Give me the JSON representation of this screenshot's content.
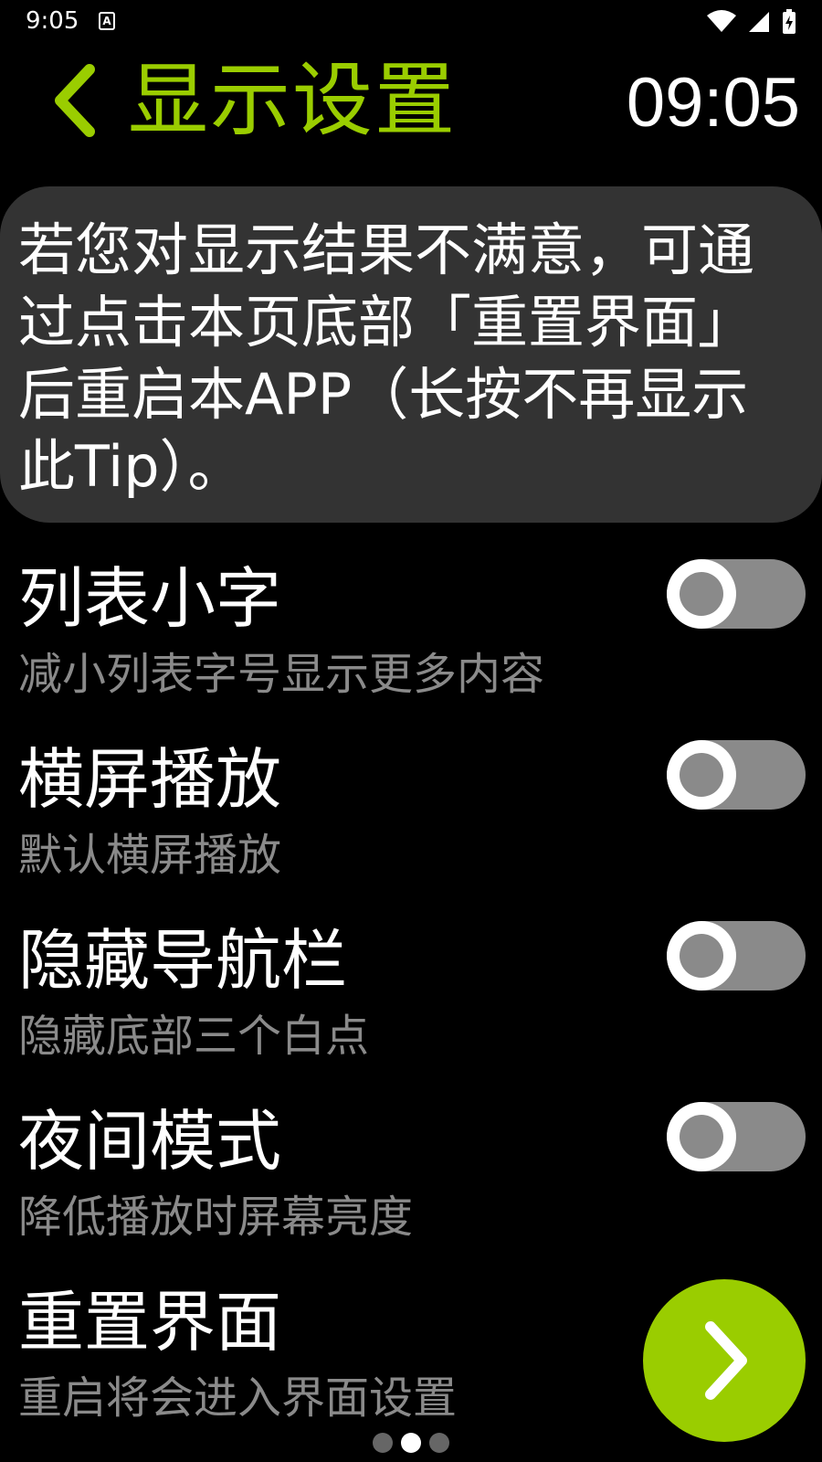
{
  "status_bar": {
    "time": "9:05",
    "notification_icon": "a-letter-icon",
    "icons": [
      "wifi-icon",
      "signal-icon",
      "battery-charging-icon"
    ]
  },
  "header": {
    "back_icon": "chevron-left-icon",
    "title": "显示设置",
    "clock": "09:05"
  },
  "tip": {
    "text": "若您对显示结果不满意，可通过点击本页底部「重置界面」后重启本APP（长按不再显示此Tip）。"
  },
  "settings": [
    {
      "title": "列表小字",
      "subtitle": "减小列表字号显示更多内容",
      "enabled": false
    },
    {
      "title": "横屏播放",
      "subtitle": "默认横屏播放",
      "enabled": false
    },
    {
      "title": "隐藏导航栏",
      "subtitle": "隐藏底部三个白点",
      "enabled": false
    },
    {
      "title": "夜间模式",
      "subtitle": "降低播放时屏幕亮度",
      "enabled": false
    }
  ],
  "reset": {
    "title": "重置界面",
    "subtitle": "重启将会进入界面设置",
    "button_icon": "chevron-right-icon"
  },
  "pager": {
    "count": 3,
    "active_index": 1
  },
  "colors": {
    "accent": "#9acd00",
    "background": "#000000",
    "tip_background": "#333333",
    "switch_off": "#8a8a8a",
    "subtitle": "#8a8a8a"
  }
}
